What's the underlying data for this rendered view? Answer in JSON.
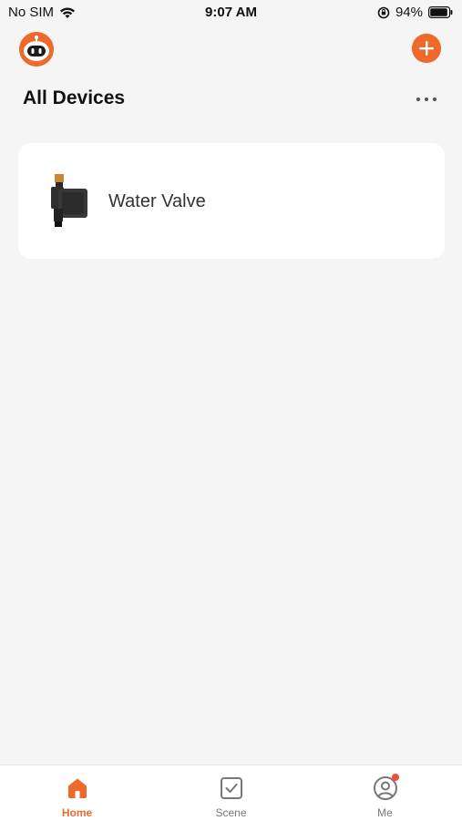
{
  "status_bar": {
    "carrier": "No SIM",
    "time": "9:07 AM",
    "battery_percent": "94%",
    "battery_level": 0.94
  },
  "header": {
    "avatar_icon": "robot-avatar-icon",
    "add_icon": "plus-circle-icon"
  },
  "page": {
    "title": "All Devices",
    "more_icon": "ellipsis-icon"
  },
  "devices": [
    {
      "name": "Water Valve",
      "icon": "water-valve-device-icon"
    }
  ],
  "tab_bar": {
    "tabs": [
      {
        "label": "Home",
        "icon": "home-icon",
        "active": true
      },
      {
        "label": "Scene",
        "icon": "scene-check-icon",
        "active": false
      },
      {
        "label": "Me",
        "icon": "user-icon",
        "active": false,
        "badge": true
      }
    ]
  },
  "colors": {
    "accent": "#ee6a2c",
    "background": "#f5f5f5",
    "card": "#ffffff",
    "badge": "#f04d3c"
  }
}
